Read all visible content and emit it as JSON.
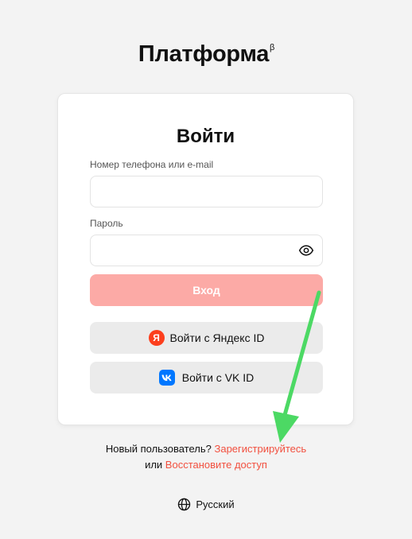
{
  "logo": {
    "text": "Платформа",
    "superscript": "β"
  },
  "login_form": {
    "title": "Войти",
    "phone_label": "Номер телефона или e-mail",
    "phone_value": "",
    "password_label": "Пароль",
    "password_value": "",
    "password_toggle_icon": "eye-icon",
    "submit_label": "Вход",
    "yandex_label": "Войти с Яндекс ID",
    "yandex_icon": "yandex-icon",
    "yandex_icon_letter": "Я",
    "vk_label": "Войти с VK ID",
    "vk_icon": "vk-icon"
  },
  "footer": {
    "new_user_text": "Новый пользователь?",
    "register_link": "Зарегистрируйтесь",
    "or_text": "или",
    "restore_link": "Восстановите доступ"
  },
  "language": {
    "label": "Русский",
    "icon": "globe-icon"
  },
  "colors": {
    "accent": "#f2503f",
    "login_button_disabled": "#fcaaa6",
    "secondary_button": "#ebebeb",
    "yandex": "#fc3f1d",
    "vk": "#0077ff",
    "annotation_arrow": "#4cd964"
  }
}
